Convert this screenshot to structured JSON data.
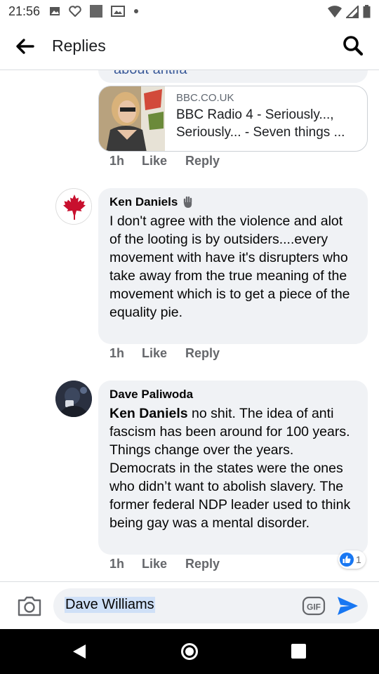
{
  "status_bar": {
    "time": "21:56",
    "icons": [
      "image-icon",
      "heart-icon",
      "square-icon",
      "gallery-icon",
      "dot-icon",
      "wifi-icon",
      "signal-icon",
      "battery-icon"
    ]
  },
  "header": {
    "title": "Replies",
    "back_icon": "arrow-left-icon",
    "search_icon": "search-icon"
  },
  "previous_comment": {
    "link_text_partial": "about antifa"
  },
  "link_preview": {
    "domain": "BBC.CO.UK",
    "title": "BBC Radio 4 - Seriously..., Seriously... - Seven things ...",
    "meta": {
      "time": "1h",
      "like": "Like",
      "reply": "Reply"
    }
  },
  "comments": [
    {
      "author": "Ken Daniels",
      "author_icon": "raised-hand-icon",
      "avatar": "canada-maple-leaf-avatar",
      "text": "I don't agree with the violence and alot of the looting is by outsiders....every movement with have it's disrupters who take away from the true meaning of the movement which is to get a piece of the equality pie.",
      "meta": {
        "time": "1h",
        "like": "Like",
        "reply": "Reply"
      }
    },
    {
      "author": "Dave Paliwoda",
      "avatar": "profile-photo-avatar",
      "mention": "Ken Daniels",
      "text": " no shit. The idea of anti fascism has been around for 100 years. Things change over the years. Democrats in the states were the ones who didn’t want to abolish slavery. The former federal NDP leader used to think being gay was a mental disorder.",
      "meta": {
        "time": "1h",
        "like": "Like",
        "reply": "Reply"
      },
      "reaction": {
        "icon": "thumbs-up-icon",
        "count": "1"
      }
    }
  ],
  "composer": {
    "value": "Dave Williams",
    "camera_icon": "camera-icon",
    "gif_label": "GIF",
    "send_icon": "send-icon"
  },
  "nav": [
    "nav-back-icon",
    "nav-home-icon",
    "nav-recents-icon"
  ],
  "colors": {
    "bubble": "#f0f2f5",
    "link": "#385898",
    "meta": "#65676b",
    "send": "#1877f2",
    "like_badge": "#1877f2"
  }
}
